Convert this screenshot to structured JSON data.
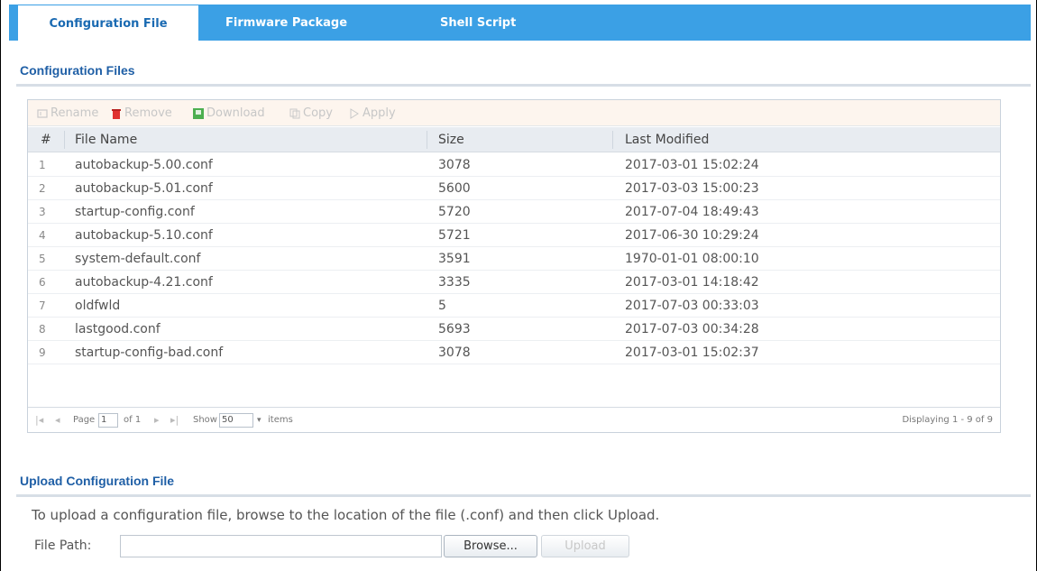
{
  "tabs": [
    {
      "label": "Configuration File",
      "active": true
    },
    {
      "label": "Firmware Package",
      "active": false
    },
    {
      "label": "Shell Script",
      "active": false
    }
  ],
  "config_section": {
    "title": "Configuration Files",
    "toolbar": {
      "rename": "Rename",
      "remove": "Remove",
      "download": "Download",
      "copy": "Copy",
      "apply": "Apply"
    },
    "columns": [
      "#",
      "File Name",
      "Size",
      "Last Modified"
    ],
    "rows": [
      {
        "num": "1",
        "name": "autobackup-5.00.conf",
        "size": "3078",
        "modified": "2017-03-01 15:02:24"
      },
      {
        "num": "2",
        "name": "autobackup-5.01.conf",
        "size": "5600",
        "modified": "2017-03-03 15:00:23"
      },
      {
        "num": "3",
        "name": "startup-config.conf",
        "size": "5720",
        "modified": "2017-07-04 18:49:43"
      },
      {
        "num": "4",
        "name": "autobackup-5.10.conf",
        "size": "5721",
        "modified": "2017-06-30 10:29:24"
      },
      {
        "num": "5",
        "name": "system-default.conf",
        "size": "3591",
        "modified": "1970-01-01 08:00:10"
      },
      {
        "num": "6",
        "name": "autobackup-4.21.conf",
        "size": "3335",
        "modified": "2017-03-01 14:18:42"
      },
      {
        "num": "7",
        "name": "oldfwld",
        "size": "5",
        "modified": "2017-07-03 00:33:03"
      },
      {
        "num": "8",
        "name": "lastgood.conf",
        "size": "5693",
        "modified": "2017-07-03 00:34:28"
      },
      {
        "num": "9",
        "name": "startup-config-bad.conf",
        "size": "3078",
        "modified": "2017-03-01 15:02:37"
      }
    ],
    "pager": {
      "page_label": "Page",
      "page_value": "1",
      "of_label": "of 1",
      "show_label": "Show",
      "show_value": "50",
      "items_label": "items",
      "displaying": "Displaying 1 - 9 of 9"
    }
  },
  "upload_section": {
    "title": "Upload Configuration File",
    "help": "To upload a configuration file, browse to the location of the file (.conf) and then click Upload.",
    "file_path_label": "File Path:",
    "file_path_value": "",
    "browse_label": "Browse...",
    "upload_label": "Upload"
  },
  "colors": {
    "tab_bar": "#3ba0e5",
    "title": "#1f5fa6",
    "remove_icon": "#e0312f",
    "download_icon": "#4caf50"
  }
}
